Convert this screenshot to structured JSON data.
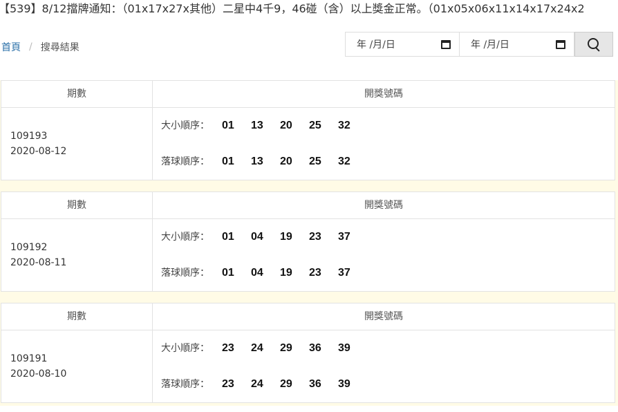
{
  "announcement": "【539】8/12擋牌通知：（01x17x27x其他）二星中4千9，46碰（含）以上獎金正常。（01x05x06x11x14x17x24x2",
  "breadcrumb": {
    "home": "首頁",
    "separator": "/",
    "current": "搜尋結果"
  },
  "date_filter": {
    "start_text": "年 /月/日",
    "end_text": "年 /月/日"
  },
  "table_header": {
    "period": "期數",
    "numbers": "開獎號碼"
  },
  "row_labels": {
    "size_order": "大小順序：",
    "drop_order": "落球順序："
  },
  "draws": [
    {
      "issue": "109193",
      "date": "2020-08-12",
      "size_order": [
        "01",
        "13",
        "20",
        "25",
        "32"
      ],
      "drop_order": [
        "01",
        "13",
        "20",
        "25",
        "32"
      ]
    },
    {
      "issue": "109192",
      "date": "2020-08-11",
      "size_order": [
        "01",
        "04",
        "19",
        "23",
        "37"
      ],
      "drop_order": [
        "01",
        "04",
        "19",
        "23",
        "37"
      ]
    },
    {
      "issue": "109191",
      "date": "2020-08-10",
      "size_order": [
        "23",
        "24",
        "29",
        "36",
        "39"
      ],
      "drop_order": [
        "23",
        "24",
        "29",
        "36",
        "39"
      ]
    }
  ]
}
